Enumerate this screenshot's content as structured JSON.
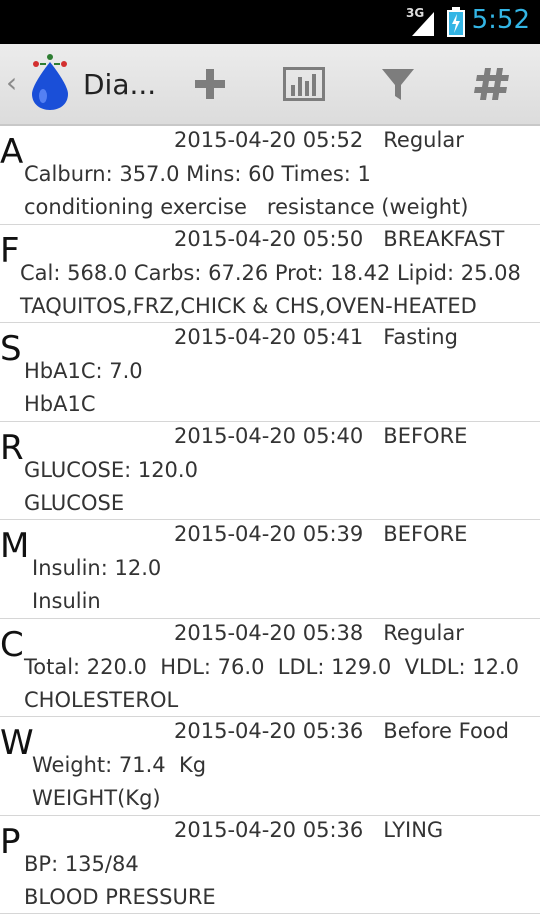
{
  "status_bar": {
    "network": "3G",
    "time": "5:52"
  },
  "action_bar": {
    "title": "Dia..."
  },
  "entries": [
    {
      "letter": "A",
      "date": "2015-04-20 05:52",
      "tag": "Regular",
      "line1": "Calburn: 357.0 Mins: 60 Times: 1",
      "line2": "conditioning exercise   resistance (weight)"
    },
    {
      "letter": "F",
      "date": "2015-04-20 05:50",
      "tag": "BREAKFAST",
      "line1": "Cal: 568.0 Carbs: 67.26 Prot: 18.42 Lipid: 25.08",
      "line2": "TAQUITOS,FRZ,CHICK & CHS,OVEN-HEATED"
    },
    {
      "letter": "S",
      "date": "2015-04-20 05:41",
      "tag": "Fasting",
      "line1": "HbA1C: 7.0",
      "line2": "HbA1C"
    },
    {
      "letter": "R",
      "date": "2015-04-20 05:40",
      "tag": "BEFORE",
      "line1": "GLUCOSE: 120.0",
      "line2": "GLUCOSE"
    },
    {
      "letter": "M",
      "date": "2015-04-20 05:39",
      "tag": "BEFORE",
      "line1": "Insulin: 12.0",
      "line2": "Insulin"
    },
    {
      "letter": "C",
      "date": "2015-04-20 05:38",
      "tag": "Regular",
      "line1": "Total: 220.0  HDL: 76.0  LDL: 129.0  VLDL: 12.0",
      "line2": "CHOLESTEROL"
    },
    {
      "letter": "W",
      "date": "2015-04-20 05:36",
      "tag": "Before Food",
      "line1": "Weight: 71.4  Kg",
      "line2": "WEIGHT(Kg)"
    },
    {
      "letter": "P",
      "date": "2015-04-20 05:36",
      "tag": "LYING",
      "line1": "BP: 135/84",
      "line2": "BLOOD PRESSURE"
    }
  ],
  "colors": {
    "clock": "#33b5e5",
    "drop": "#1a4fd8",
    "icon_gray": "#7d7d7d"
  },
  "icons": {
    "add": "plus-icon",
    "chart": "bar-chart-icon",
    "filter": "filter-icon",
    "settings": "hash-icon"
  }
}
